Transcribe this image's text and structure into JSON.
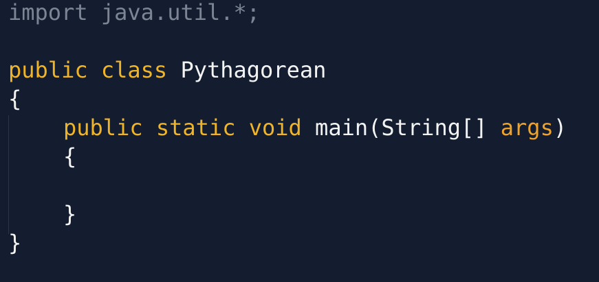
{
  "code": {
    "import_line": "import java.util.*;",
    "class_kw_public": "public",
    "class_kw_class": "class",
    "class_name": "Pythagorean",
    "open_brace_outer": "{",
    "method_kw_public": "public",
    "method_kw_static": "static",
    "method_kw_void": "void",
    "method_name_and_param_type": "main(String[]",
    "param_name": "args",
    "close_paren": ")",
    "open_brace_inner": "{",
    "close_brace_inner": "}",
    "close_brace_outer": "}"
  },
  "colors": {
    "background": "#131d2f",
    "keyword": "#f0b429",
    "parameter": "#f0a32a",
    "plain_text": "#f3f3f3",
    "import_text": "#7d8594",
    "indent_guide": "#2b3547"
  }
}
